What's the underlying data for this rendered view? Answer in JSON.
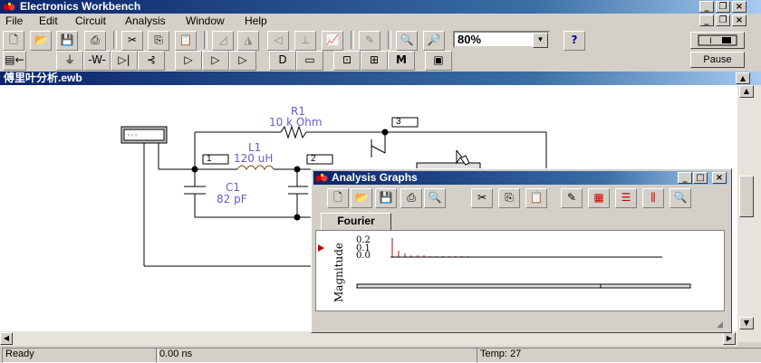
{
  "app": {
    "title": "Electronics Workbench"
  },
  "menu": [
    "File",
    "Edit",
    "Circuit",
    "Analysis",
    "Window",
    "Help"
  ],
  "toolbar": {
    "zoom_value": "80%",
    "help_label": "?",
    "pause_label": "Pause",
    "m_label": "M"
  },
  "document": {
    "title": "傅里叶分析.ewb"
  },
  "circuit": {
    "r1_name": "R1",
    "r1_value": "10 k Ohm",
    "l1_name": "L1",
    "l1_value": "120 uH",
    "c1_name": "C1",
    "c1_value": "82 pF",
    "node1": "1",
    "node2": "2",
    "node3": "3"
  },
  "graphs": {
    "title": "Analysis Graphs",
    "tab": "Fourier",
    "ylabel": "Magnitude",
    "tick_top": "0.2",
    "tick_mid": "0.1",
    "tick_zero": "0.0"
  },
  "status": {
    "ready": "Ready",
    "time": "0.00 ns",
    "temp": "Temp:  27"
  },
  "colors": {
    "title_blue": "#0a246a",
    "component_purple": "#6a5acd",
    "plot_red": "#c00000"
  }
}
